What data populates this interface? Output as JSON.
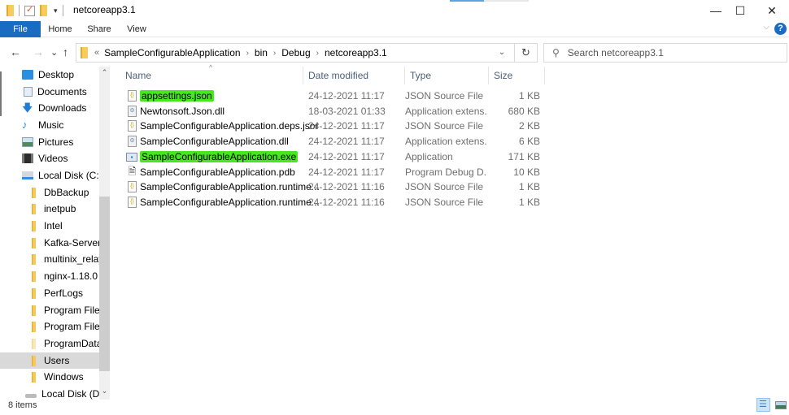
{
  "window": {
    "title": "netcoreapp3.1",
    "controls": {
      "minimize": "—",
      "maximize": "☐",
      "close": "✕"
    }
  },
  "ribbon": {
    "tabs": [
      {
        "label": "File",
        "active": true
      },
      {
        "label": "Home"
      },
      {
        "label": "Share"
      },
      {
        "label": "View"
      }
    ],
    "collapse_icon": "⌵",
    "help_icon": "?"
  },
  "nav": {
    "back": "←",
    "forward": "→",
    "recent": "⌄",
    "up": "↑",
    "breadcrumb_overflow": "«",
    "breadcrumb": [
      "SampleConfigurableApplication",
      "bin",
      "Debug",
      "netcoreapp3.1"
    ],
    "breadcrumb_sep": "›",
    "address_dropdown": "⌄",
    "refresh": "↻",
    "search_placeholder": "Search netcoreapp3.1",
    "search_icon": "⚲"
  },
  "sidebar": {
    "items": [
      {
        "label": "Desktop",
        "icon": "desktop-icon"
      },
      {
        "label": "Documents",
        "icon": "documents-icon"
      },
      {
        "label": "Downloads",
        "icon": "downloads-icon"
      },
      {
        "label": "Music",
        "icon": "music-icon"
      },
      {
        "label": "Pictures",
        "icon": "pictures-icon"
      },
      {
        "label": "Videos",
        "icon": "videos-icon"
      },
      {
        "label": "Local Disk (C:)",
        "icon": "disk-icon"
      },
      {
        "label": "DbBackup",
        "icon": "folder-icon"
      },
      {
        "label": "inetpub",
        "icon": "folder-icon"
      },
      {
        "label": "Intel",
        "icon": "folder-icon"
      },
      {
        "label": "Kafka-Server",
        "icon": "folder-icon"
      },
      {
        "label": "multinix_relays",
        "icon": "folder-icon"
      },
      {
        "label": "nginx-1.18.0",
        "icon": "folder-icon"
      },
      {
        "label": "PerfLogs",
        "icon": "folder-icon"
      },
      {
        "label": "Program Files",
        "icon": "folder-icon"
      },
      {
        "label": "Program Files (",
        "icon": "folder-icon"
      },
      {
        "label": "ProgramData",
        "icon": "folder-icon"
      },
      {
        "label": "Users",
        "icon": "folder-icon",
        "selected": true
      },
      {
        "label": "Windows",
        "icon": "folder-icon"
      },
      {
        "label": "Local Disk (D:)",
        "icon": "disk-icon"
      }
    ],
    "scroll_up": "⌃",
    "scroll_down": "⌄"
  },
  "columns": {
    "name": "Name",
    "date": "Date modified",
    "type": "Type",
    "size": "Size",
    "sort_indicator": "^"
  },
  "files": [
    {
      "name": "appsettings.json",
      "date": "24-12-2021 11:17",
      "type": "JSON Source File",
      "size": "1 KB",
      "icon": "json",
      "highlighted": true
    },
    {
      "name": "Newtonsoft.Json.dll",
      "date": "18-03-2021 01:33",
      "type": "Application extens...",
      "size": "680 KB",
      "icon": "dll"
    },
    {
      "name": "SampleConfigurableApplication.deps.json",
      "date": "24-12-2021 11:17",
      "type": "JSON Source File",
      "size": "2 KB",
      "icon": "json"
    },
    {
      "name": "SampleConfigurableApplication.dll",
      "date": "24-12-2021 11:17",
      "type": "Application extens...",
      "size": "6 KB",
      "icon": "dll"
    },
    {
      "name": "SampleConfigurableApplication.exe",
      "date": "24-12-2021 11:17",
      "type": "Application",
      "size": "171 KB",
      "icon": "exe",
      "highlighted": true
    },
    {
      "name": "SampleConfigurableApplication.pdb",
      "date": "24-12-2021 11:17",
      "type": "Program Debug D...",
      "size": "10 KB",
      "icon": "pdb"
    },
    {
      "name": "SampleConfigurableApplication.runtime...",
      "date": "24-12-2021 11:16",
      "type": "JSON Source File",
      "size": "1 KB",
      "icon": "json"
    },
    {
      "name": "SampleConfigurableApplication.runtime...",
      "date": "24-12-2021 11:16",
      "type": "JSON Source File",
      "size": "1 KB",
      "icon": "json"
    }
  ],
  "status": {
    "item_count": "8 items"
  },
  "colors": {
    "accent": "#1a6bc2",
    "highlight": "#47e61e",
    "selected_bg": "#d9d9d9"
  }
}
